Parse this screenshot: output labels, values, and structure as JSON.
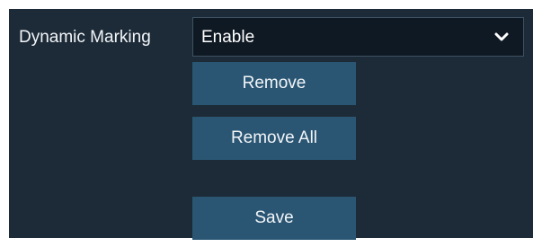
{
  "dynamic_marking": {
    "label": "Dynamic Marking",
    "selected": "Enable"
  },
  "icons": {
    "dropdown": "chevron-down-icon"
  },
  "buttons": {
    "remove": "Remove",
    "remove_all": "Remove All",
    "save": "Save"
  },
  "colors": {
    "panel_bg": "#1d2b38",
    "select_bg": "#0f1924",
    "button_bg": "#2a5673",
    "text": "#f2f5f8"
  }
}
